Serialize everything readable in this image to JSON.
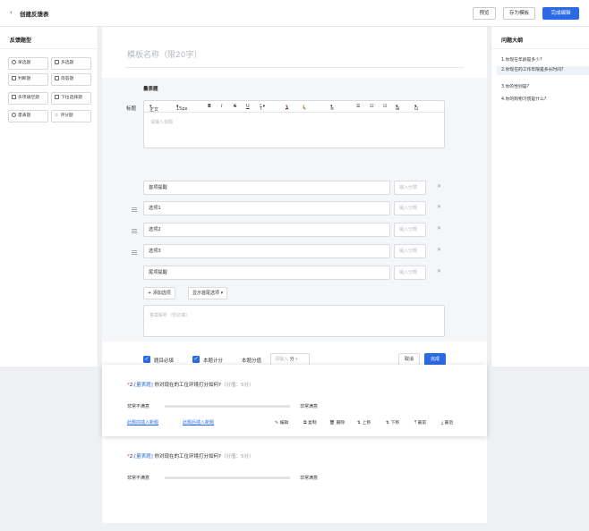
{
  "header": {
    "back_icon": "chevron-left-icon",
    "title": "创建反馈表",
    "preview": "预览",
    "save_template": "存为模板",
    "finish_edit": "完成编辑",
    "accent": "#2b6ae5"
  },
  "left_panel": {
    "title": "反馈题型",
    "types": [
      {
        "label": "单选题",
        "icon": "radio-icon"
      },
      {
        "label": "多选题",
        "icon": "checkbox-icon"
      },
      {
        "label": "判断题",
        "icon": "judge-icon"
      },
      {
        "label": "简答题",
        "icon": "text-icon"
      },
      {
        "label": "多项填空题",
        "icon": "grid-icon"
      },
      {
        "label": "下拉选择题",
        "icon": "dropdown-icon"
      },
      {
        "label": "量表题",
        "icon": "scale-icon"
      },
      {
        "label": "评分题",
        "icon": "star-icon"
      }
    ]
  },
  "right_panel": {
    "title": "问题大纲",
    "items": [
      "1.你现在年龄是多少?",
      "2.你现在的工作年限是多长时间?",
      "3.你的性别是?",
      "4.你的购物习惯是什么?"
    ],
    "active_index": 1
  },
  "canvas": {
    "template_name_placeholder": "模板名称（限20字）",
    "editor": {
      "question_type": "量表题",
      "title_label": "标题",
      "toolbar": {
        "font_family": "正文",
        "font_size": "15px",
        "bold": "B",
        "italic": "I",
        "strike": "S",
        "underline": "U",
        "superscript": "T",
        "font_color": "A",
        "highlight": "✎",
        "align": "≡",
        "ordered_list": "☰",
        "bullet_list": "☷",
        "checklist": "☑",
        "table": "⊞",
        "image": "⊡"
      },
      "title_placeholder": "请输入标题",
      "options": [
        {
          "label": "首项提醒",
          "draggable": false
        },
        {
          "label": "选项1",
          "draggable": true
        },
        {
          "label": "选项2",
          "draggable": true
        },
        {
          "label": "选项3",
          "draggable": true
        },
        {
          "label": "尾项提醒",
          "draggable": false
        }
      ],
      "score_placeholder": "输入分数",
      "add_option": "+ 添加选项",
      "show_first_last": "显示首尾选项",
      "analysis_placeholder": "答案解析（非必填）",
      "required_label": "题目必填",
      "scoring_label": "本题计分",
      "score_value_label": "本题分值",
      "score_value_placeholder": "请输入",
      "score_unit": "分",
      "cancel": "取消",
      "done": "完成"
    },
    "question_card": {
      "required_star": "*",
      "number": "2.",
      "kind": "[量表题]",
      "text": "你对现在的工位环境打分如何?",
      "points": "（分值：5分）",
      "left_label": "非常不满意",
      "right_label": "非常满意",
      "insert_before": "此题前插入新题",
      "insert_after": "此题后插入新题",
      "actions": [
        {
          "label": "编辑",
          "icon": "edit-icon",
          "glyph": "✎"
        },
        {
          "label": "复制",
          "icon": "copy-icon",
          "glyph": "⧉"
        },
        {
          "label": "删除",
          "icon": "trash-icon",
          "glyph": "🗑"
        },
        {
          "label": "上移",
          "icon": "move-up-icon",
          "glyph": "⇅"
        },
        {
          "label": "下移",
          "icon": "move-down-icon",
          "glyph": "⇅"
        },
        {
          "label": "最前",
          "icon": "to-top-icon",
          "glyph": "⤒"
        },
        {
          "label": "最后",
          "icon": "to-bottom-icon",
          "glyph": "⤓"
        }
      ]
    },
    "question_static": {
      "required_star": "*",
      "number": "2.",
      "kind": "[量表题]",
      "text": "你对现在的工位环境打分如何?",
      "points": "（分值：5分）",
      "left_label": "非常不满意",
      "right_label": "非常满意"
    }
  }
}
